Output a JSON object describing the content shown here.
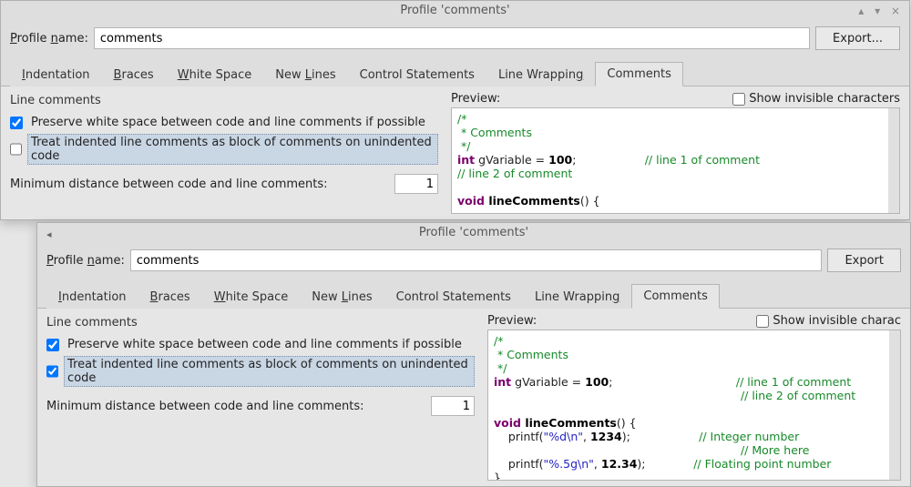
{
  "window1": {
    "title": "Profile 'comments'",
    "profile_label": "Profile name:",
    "profile_value": "comments",
    "export_label": "Export...",
    "tabs": {
      "t0": "Indentation",
      "t1": "Braces",
      "t2": "White Space",
      "t3": "New Lines",
      "t4": "Control Statements",
      "t5": "Line Wrapping",
      "t6": "Comments"
    },
    "group_title": "Line comments",
    "chk1_label": "Preserve white space between code and line comments if possible",
    "chk2_label": "Treat indented line comments as block of comments on unindented code",
    "min_label": "Minimum distance between code and line comments:",
    "min_value": "1",
    "preview_label": "Preview:",
    "show_invis_label": "Show invisible characters"
  },
  "window2": {
    "title": "Profile 'comments'",
    "profile_label": "Profile name:",
    "profile_value": "comments",
    "export_label": "Export",
    "tabs": {
      "t0": "Indentation",
      "t1": "Braces",
      "t2": "White Space",
      "t3": "New Lines",
      "t4": "Control Statements",
      "t5": "Line Wrapping",
      "t6": "Comments"
    },
    "group_title": "Line comments",
    "chk1_label": "Preserve white space between code and line comments if possible",
    "chk2_label": "Treat indented line comments as block of comments on unindented code",
    "min_label": "Minimum distance between code and line comments:",
    "min_value": "1",
    "preview_label": "Preview:",
    "show_invis_label": "Show invisible charac"
  },
  "code1": {
    "l1": "/*",
    "l2": " * Comments",
    "l3": " */",
    "l4a": "int",
    "l4b": " gVariable = ",
    "l4c": "100",
    "l4d": ";",
    "l4e": "// line 1 of comment",
    "l5": "// line 2 of comment",
    "l7a": "void",
    "l7b": " lineComments",
    "l7c": "() {"
  },
  "code2": {
    "l1": "/*",
    "l2": " * Comments",
    "l3": " */",
    "l4a": "int",
    "l4b": " gVariable = ",
    "l4c": "100",
    "l4d": ";",
    "l4e": "// line 1 of comment",
    "l5": "// line 2 of comment",
    "l7a": "void",
    "l7b": " lineComments",
    "l7c": "() {",
    "l8a": "    printf(",
    "l8b": "\"%d\\n\"",
    "l8c": ", ",
    "l8d": "1234",
    "l8e": ");",
    "l8f": "// Integer number",
    "l9": "// More here",
    "l10a": "    printf(",
    "l10b": "\"%.5g\\n\"",
    "l10c": ", ",
    "l10d": "12.34",
    "l10e": ");",
    "l10f": "// Floating point number",
    "l11": "}"
  }
}
